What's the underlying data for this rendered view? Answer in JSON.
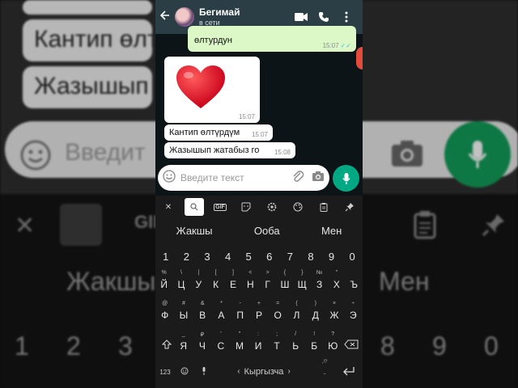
{
  "header": {
    "contact_name": "Бегимай",
    "status": "в сети"
  },
  "messages": [
    {
      "direction": "out",
      "text": "өлтурдун",
      "time": "15:07",
      "read": true
    },
    {
      "direction": "in",
      "type": "sticker",
      "emoji": "❤",
      "time": "15:07"
    },
    {
      "direction": "in",
      "text": "Кантип өлтүрдүм",
      "time": "15:07"
    },
    {
      "direction": "in",
      "text": "Жазышып жатабыз го",
      "time": "15:08"
    }
  ],
  "composer": {
    "placeholder": "Введите текст"
  },
  "keyboard": {
    "toolbar": [
      "close",
      "search",
      "gif",
      "sticker",
      "settings",
      "theme",
      "clipboard",
      "pin"
    ],
    "toolbar_labels": {
      "gif": "GIF"
    },
    "suggestions": [
      "Жакшы",
      "Ооба",
      "Мен"
    ],
    "numbers": [
      "1",
      "2",
      "3",
      "4",
      "5",
      "6",
      "7",
      "8",
      "9",
      "0"
    ],
    "row1": [
      {
        "sup": "%",
        "main": "Й"
      },
      {
        "sup": "\\",
        "main": "Ц"
      },
      {
        "sup": "|",
        "main": "У"
      },
      {
        "sup": "[",
        "main": "К"
      },
      {
        "sup": "]",
        "main": "Е"
      },
      {
        "sup": "<",
        "main": "Н"
      },
      {
        "sup": ">",
        "main": "Г"
      },
      {
        "sup": "{",
        "main": "Ш"
      },
      {
        "sup": "}",
        "main": "Щ"
      },
      {
        "sup": "№",
        "main": "З"
      },
      {
        "sup": "\"",
        "main": "Х"
      },
      {
        "sup": "",
        "main": "Ъ"
      }
    ],
    "row2": [
      {
        "sup": "@",
        "main": "Ф"
      },
      {
        "sup": "#",
        "main": "Ы"
      },
      {
        "sup": "&",
        "main": "В"
      },
      {
        "sup": "*",
        "main": "А"
      },
      {
        "sup": "-",
        "main": "П"
      },
      {
        "sup": "+",
        "main": "Р"
      },
      {
        "sup": "=",
        "main": "О"
      },
      {
        "sup": "(",
        "main": "Л"
      },
      {
        "sup": ")",
        "main": "Д"
      },
      {
        "sup": "×",
        "main": "Ж"
      },
      {
        "sup": "÷",
        "main": "Э"
      }
    ],
    "row3": [
      {
        "sup": "_",
        "main": "Я"
      },
      {
        "sup": "₽",
        "main": "Ч"
      },
      {
        "sup": "'",
        "main": "С"
      },
      {
        "sup": "\"",
        "main": "М"
      },
      {
        "sup": ":",
        "main": "И"
      },
      {
        "sup": ";",
        "main": "Т"
      },
      {
        "sup": "/",
        "main": "Ь"
      },
      {
        "sup": "!",
        "main": "Б"
      },
      {
        "sup": "?",
        "main": "Ю"
      }
    ],
    "symbols_label": "123",
    "language_label": "Кыргызча",
    "language_prev": "‹",
    "language_next": "›",
    "period_sup": ",!?",
    "period": "."
  },
  "colors": {
    "appbar": "#2b3e45",
    "outgoing": "#dcf8c6",
    "incoming": "#ffffff",
    "accent": "#00a884",
    "read_ticks": "#4fb6ec"
  },
  "backdrop": {
    "bubble_texts": [
      "Кантип өлтүр",
      "Жазышып ж"
    ],
    "input_placeholder": "Введит",
    "suggestions": [
      "Жакшы",
      "Мен"
    ],
    "numbers": [
      "1",
      "2",
      "3",
      "8",
      "9",
      "0"
    ],
    "gif_label": "GIF"
  }
}
